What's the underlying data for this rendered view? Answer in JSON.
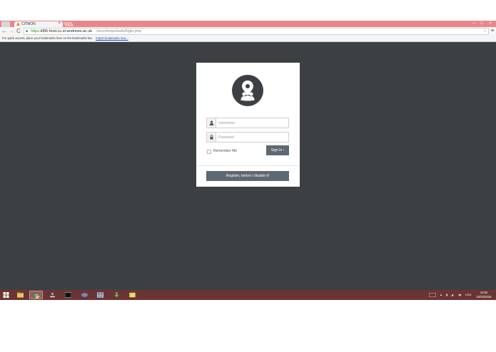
{
  "browser": {
    "tab_title": "CITMON",
    "tab_close": "×",
    "window_controls": {
      "minimize": "–",
      "maximize": "□",
      "close": "×"
    },
    "nav": {
      "back": "←",
      "forward": "→",
      "reload": "C"
    },
    "url": {
      "scheme": "https://",
      "host": "cl95.host.cs.st-andrews.ac.uk",
      "path": "/secretrepo/web/login.php",
      "star": "☆"
    },
    "menu": "≡",
    "bookmarks_bar": {
      "hint": "For quick access, place your bookmarks here on the bookmarks bar.",
      "import_link": "Import bookmarks now..."
    }
  },
  "login": {
    "username_placeholder": "Username",
    "password_placeholder": "Password",
    "remember_label": "Remember Me",
    "signin_label": "Sign In  ›",
    "register_label": "Register, before I disable it!"
  },
  "taskbar": {
    "tray": {
      "arrow": "▲",
      "language": "ENG"
    },
    "clock_time": "13:02",
    "clock_date": "22/02/2015"
  },
  "colors": {
    "tab_bar": "#e8868c",
    "page_background": "#3d4043",
    "button": "#5d6870",
    "taskbar": "#6b3434"
  }
}
